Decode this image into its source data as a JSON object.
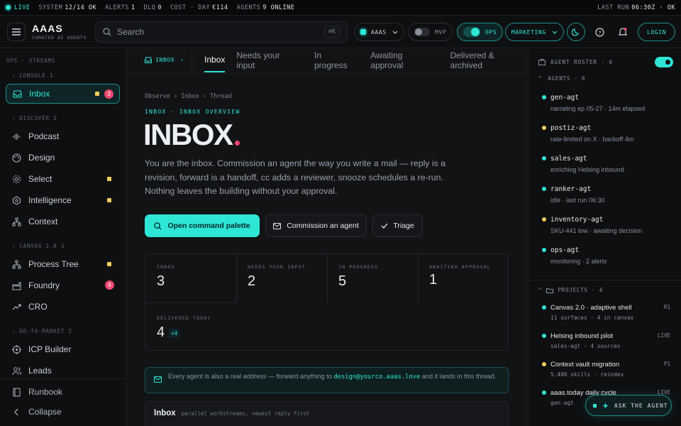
{
  "statusbar": {
    "live": "LIVE",
    "system_label": "SYSTEM",
    "system_val": "12/14 OK",
    "alerts_label": "ALERTS",
    "alerts_val": "1",
    "dlq_label": "DLQ",
    "dlq_val": "0",
    "cost_label": "COST · DAY",
    "cost_val": "€114",
    "agents_label": "AGENTS",
    "agents_val": "9 ONLINE",
    "lastrun_label": "LAST RUN",
    "lastrun_val": "06:30Z · OK"
  },
  "topbar": {
    "title": "AAAS",
    "subtitle": "CURATED AI AGENTS",
    "search_placeholder": "Search",
    "search_shortcut": "⌘K",
    "workspace": "AAAS",
    "mvp": "MVP",
    "ops": "OPS",
    "marketing": "MARKETING",
    "login": "LOGIN"
  },
  "sidebar": {
    "header": "OPS · STREAMS",
    "sections": {
      "console": "CONSOLE 1",
      "discover": "DISCOVER 5",
      "canvas": "CANVAS 2.0 3",
      "gtm": "GO-TO-MARKET 2"
    },
    "items": {
      "inbox": {
        "label": "Inbox",
        "badge": "3"
      },
      "podcast": {
        "label": "Podcast"
      },
      "design": {
        "label": "Design"
      },
      "select": {
        "label": "Select"
      },
      "intelligence": {
        "label": "Intelligence"
      },
      "context": {
        "label": "Context"
      },
      "processtree": {
        "label": "Process Tree"
      },
      "foundry": {
        "label": "Foundry",
        "badge": "6"
      },
      "cro": {
        "label": "CRO"
      },
      "icp": {
        "label": "ICP Builder"
      },
      "leads": {
        "label": "Leads"
      },
      "runbook": {
        "label": "Runbook"
      },
      "collapse": {
        "label": "Collapse"
      }
    }
  },
  "main": {
    "chip": "INBOX",
    "tabs": [
      "Inbox",
      "Needs your input",
      "In progress",
      "Awaiting approval",
      "Delivered & archived"
    ],
    "breadcrumb": [
      "Observe",
      "Inbox",
      "Thread"
    ],
    "eyebrow": "INBOX · INBOX OVERVIEW",
    "title": "INBOX",
    "description": "You are the inbox. Commission an agent the way you write a mail — reply is a revision, forward is a handoff, cc adds a reviewer, snooze schedules a re-run. Nothing leaves the building without your approval.",
    "actions": {
      "palette": "Open command palette",
      "commission": "Commission an agent",
      "triage": "Triage"
    },
    "stats": [
      {
        "label": "INBOX",
        "value": "3"
      },
      {
        "label": "NEEDS YOUR INPUT",
        "value": "2"
      },
      {
        "label": "IN PROGRESS",
        "value": "5"
      },
      {
        "label": "AWAITING APPROVAL",
        "value": "1"
      },
      {
        "label": "DELIVERED TODAY",
        "value": "4",
        "delta": "+4"
      }
    ],
    "notice_pre": "Every agent is also a real address — forward anything to ",
    "notice_email": "design@yourco.aaas.love",
    "notice_post": " and it lands in this thread.",
    "list_title": "Inbox",
    "list_sub": "parallel workstreams, newest reply first"
  },
  "roster": {
    "title": "AGENT ROSTER · 6",
    "agents_header": "AGENTS · 6",
    "projects_header": "PROJECTS · 4",
    "agents": [
      {
        "name": "gen-agt",
        "desc": "narrating ep 05-27 · 14m elapsed",
        "color": "#2ee6d6"
      },
      {
        "name": "postiz-agt",
        "desc": "rate-limited on X · backoff 4m",
        "color": "#f2cd5e"
      },
      {
        "name": "sales-agt",
        "desc": "enriching Helsing inbound",
        "color": "#2ee6d6"
      },
      {
        "name": "ranker-agt",
        "desc": "idle · last run 06:30",
        "color": "#2ee6d6"
      },
      {
        "name": "inventory-agt",
        "desc": "SKU-441 low · awaiting decision",
        "color": "#f2cd5e"
      },
      {
        "name": "ops-agt",
        "desc": "monitoring · 2 alerts",
        "color": "#2ee6d6"
      }
    ],
    "projects": [
      {
        "name": "Canvas 2.0 · adaptive shell",
        "desc": "11 surfaces · 4 in canvas",
        "tag": "R1",
        "color": "#2ee6d6"
      },
      {
        "name": "Helsing inbound pilot",
        "desc": "sales-agt · 4 sources",
        "tag": "LIVE",
        "color": "#2ee6d6"
      },
      {
        "name": "Context vault migration",
        "desc": "5,400 skills · reindex",
        "tag": "P1",
        "color": "#f2cd5e"
      },
      {
        "name": "aaas.today daily cycle",
        "desc": "gen-agt",
        "tag": "LIVE",
        "color": "#2ee6d6"
      }
    ],
    "ask": "ASK THE AGENT"
  }
}
